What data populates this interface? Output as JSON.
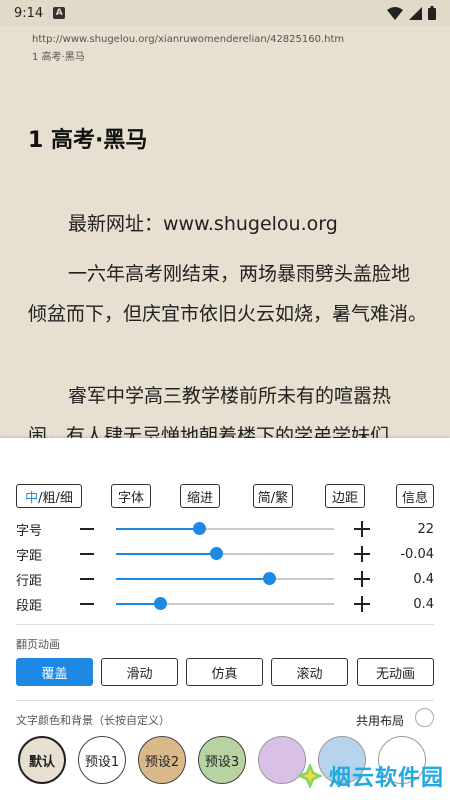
{
  "status_bar": {
    "time": "9:14",
    "notif_icon": "A"
  },
  "reader": {
    "url": "http://www.shugelou.org/xianruwomenderelian/42825160.htm",
    "chapter_small": "1 高考·黑马",
    "chapter_title": "1 高考·黑马",
    "paragraphs": [
      "最新网址：www.shugelou.org",
      "一六年高考刚结束，两场暴雨劈头盖脸地倾盆而下，但庆宜市依旧火云如烧，暑气难消。",
      "睿军中学高三教学楼前所未有的喧嚣热闹，有人肆无忌惮地朝着楼下的学弟学妹们喊：“加油！你们都能考上清华北大！”"
    ]
  },
  "toolbar": {
    "weight_active": "中",
    "weight_rest": "/粗/细",
    "font": "字体",
    "indent": "缩进",
    "simp_trad": "简/繁",
    "margin": "边距",
    "info": "信息"
  },
  "sliders": [
    {
      "label": "字号",
      "value": "22",
      "fraction": 0.38
    },
    {
      "label": "字距",
      "value": "-0.04",
      "fraction": 0.46
    },
    {
      "label": "行距",
      "value": "0.4",
      "fraction": 0.7
    },
    {
      "label": "段距",
      "value": "0.4",
      "fraction": 0.2
    }
  ],
  "page_anim": {
    "label": "翻页动画",
    "options": [
      "覆盖",
      "滑动",
      "仿真",
      "滚动",
      "无动画"
    ],
    "selected": "覆盖"
  },
  "color_section": {
    "label": "文字颜色和背景（长按自定义）",
    "shared_layout": "共用布局",
    "swatches": [
      {
        "label": "默认",
        "color": "#e7dfcf"
      },
      {
        "label": "预设1",
        "color": "#ffffff"
      },
      {
        "label": "预设2",
        "color": "#d9b98a"
      },
      {
        "label": "预设3",
        "color": "#b7d3a2"
      },
      {
        "label": "",
        "color": "#d8c0e6"
      },
      {
        "label": "",
        "color": "#b8d4ec"
      },
      {
        "label": "",
        "color": "#ffffff"
      }
    ]
  },
  "watermark": "烟云软件园",
  "colors": {
    "accent": "#1e88e5",
    "paper": "#e7dfcf"
  }
}
